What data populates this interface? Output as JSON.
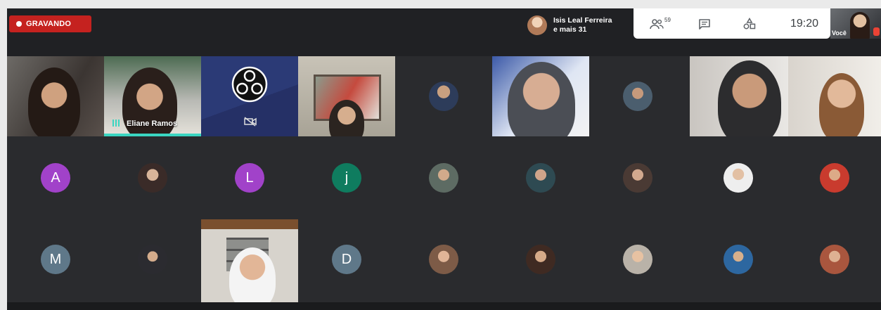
{
  "recording": {
    "label": "GRAVANDO"
  },
  "presenter": {
    "name": "Isis Leal Ferreira",
    "others": "e mais 31"
  },
  "controls": {
    "participants_count": "59",
    "time": "19:20"
  },
  "self_view": {
    "label": "Você"
  },
  "participants": [
    {
      "kind": "video",
      "label": ""
    },
    {
      "kind": "video",
      "label": "Eliane Ramos",
      "speaking": true
    },
    {
      "kind": "obs",
      "label": "",
      "camera_off": true
    },
    {
      "kind": "video",
      "label": ""
    },
    {
      "kind": "photo",
      "label": ""
    },
    {
      "kind": "video",
      "label": ""
    },
    {
      "kind": "photo",
      "label": ""
    },
    {
      "kind": "video",
      "label": ""
    },
    {
      "kind": "video",
      "label": ""
    },
    {
      "kind": "initial",
      "initial": "A",
      "color": "#a142c9"
    },
    {
      "kind": "photo",
      "label": ""
    },
    {
      "kind": "initial",
      "initial": "L",
      "color": "#a142c9"
    },
    {
      "kind": "initial",
      "initial": "j",
      "color": "#0f7c5f"
    },
    {
      "kind": "photo",
      "label": ""
    },
    {
      "kind": "photo",
      "label": ""
    },
    {
      "kind": "photo",
      "label": ""
    },
    {
      "kind": "photo",
      "label": ""
    },
    {
      "kind": "photo",
      "label": ""
    },
    {
      "kind": "initial",
      "initial": "M",
      "color": "#5f7889"
    },
    {
      "kind": "photo",
      "label": ""
    },
    {
      "kind": "video",
      "label": ""
    },
    {
      "kind": "initial",
      "initial": "D",
      "color": "#5f7889"
    },
    {
      "kind": "photo",
      "label": ""
    },
    {
      "kind": "photo",
      "label": ""
    },
    {
      "kind": "photo",
      "label": ""
    },
    {
      "kind": "photo",
      "label": ""
    },
    {
      "kind": "photo",
      "label": ""
    }
  ],
  "colors": {
    "background": "#202124",
    "recording": "#c5221f",
    "speaking": "#3ad6c1"
  }
}
